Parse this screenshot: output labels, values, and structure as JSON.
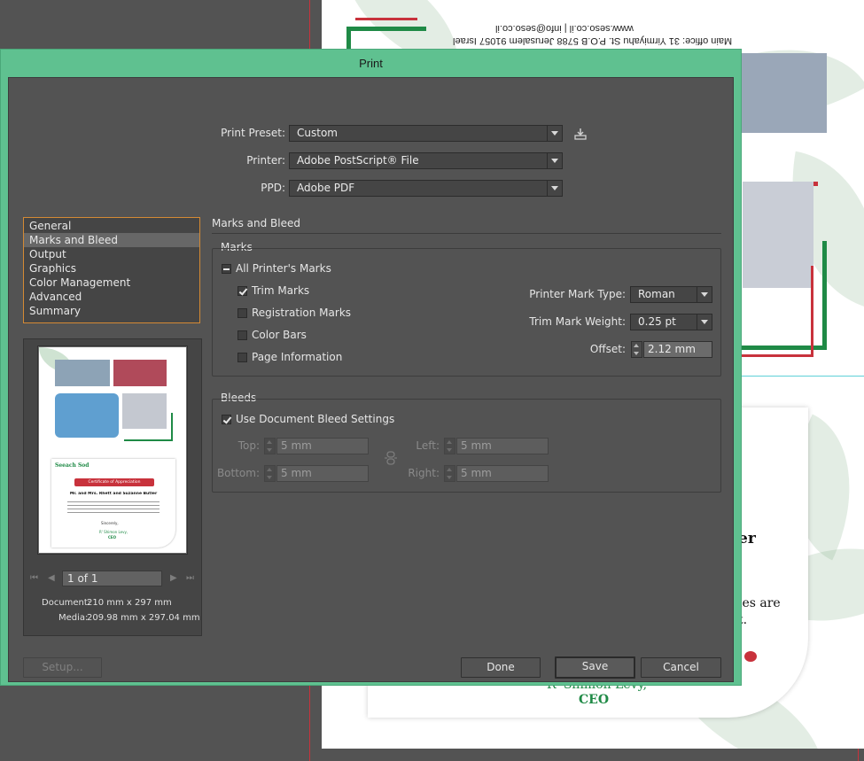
{
  "background_doc": {
    "address_line1": "Main office: 31 Yirmiyahu St. P.O.B 5788 Jerusalem 91057 Israel",
    "address_line2": "www.seso.co.il | info@seso.co.il",
    "cert_heading_fragment": "er",
    "cert_body_fragment1": "ies are",
    "cert_body_fragment2": "t.",
    "signer": "R' Shimon Levy,",
    "signer_title": "CEO"
  },
  "dialog": {
    "title": "Print",
    "preset": {
      "label": "Print Preset:",
      "value": "Custom"
    },
    "printer": {
      "label": "Printer:",
      "value": "Adobe PostScript® File"
    },
    "ppd": {
      "label": "PPD:",
      "value": "Adobe PDF"
    },
    "categories": [
      "General",
      "Marks and Bleed",
      "Output",
      "Graphics",
      "Color Management",
      "Advanced",
      "Summary"
    ],
    "selected_category": "Marks and Bleed",
    "preview": {
      "page_indicator": "1 of 1",
      "document_label": "Document:",
      "document_size": "210 mm x 297 mm",
      "media_label": "Media:",
      "media_size": "209.98 mm x 297.04 mm",
      "thumb_org": "Seeach Sod",
      "thumb_heading": "Certificate of Appreciation",
      "thumb_names": "Mr. and Mrs. Rhett and Suzanne Butler",
      "thumb_sincerely": "Sincerely,",
      "thumb_signer": "R' Shimon Levy,",
      "thumb_title": "CEO"
    },
    "section_title": "Marks and Bleed",
    "marks": {
      "group_title": "Marks",
      "all_printers_marks": "All Printer's Marks",
      "trim_marks": "Trim Marks",
      "registration_marks": "Registration Marks",
      "color_bars": "Color Bars",
      "page_information": "Page Information",
      "printer_mark_type_label": "Printer Mark Type:",
      "printer_mark_type_value": "Roman",
      "trim_mark_weight_label": "Trim Mark Weight:",
      "trim_mark_weight_value": "0.25 pt",
      "offset_label": "Offset:",
      "offset_value": "2.12 mm"
    },
    "bleeds": {
      "group_title": "Bleeds",
      "use_document_bleed": "Use Document Bleed Settings",
      "top_label": "Top:",
      "top_value": "5 mm",
      "bottom_label": "Bottom:",
      "bottom_value": "5 mm",
      "left_label": "Left:",
      "left_value": "5 mm",
      "right_label": "Right:",
      "right_value": "5 mm"
    },
    "buttons": {
      "setup": "Setup...",
      "done": "Done",
      "save": "Save",
      "cancel": "Cancel"
    }
  },
  "colors": {
    "dialog_frame": "#5fc190",
    "panel": "#535353",
    "selection_outline": "#d48a34",
    "brand_green": "#1f8a46",
    "brand_red": "#c8323c"
  }
}
